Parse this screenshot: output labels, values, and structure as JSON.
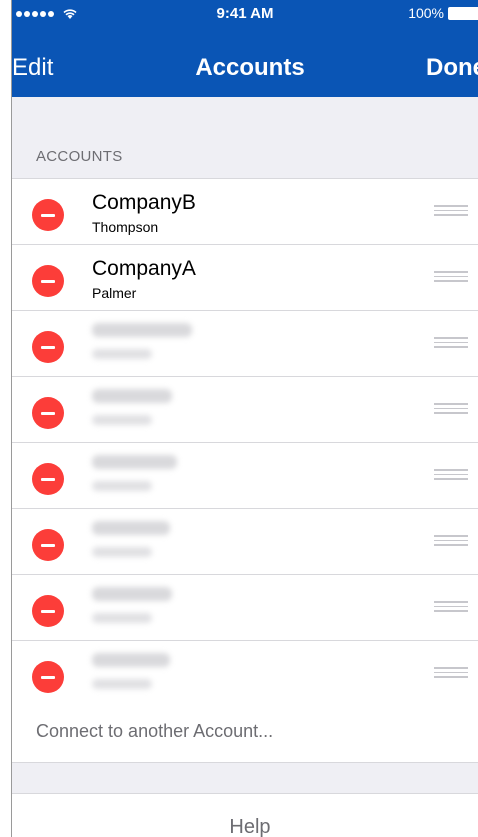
{
  "status_bar": {
    "time": "9:41 AM",
    "battery": "100%"
  },
  "nav": {
    "left_label": "Edit",
    "title": "Accounts",
    "right_label": "Done"
  },
  "section": {
    "header": "ACCOUNTS"
  },
  "accounts": [
    {
      "name": "CompanyB",
      "user": "Thompson"
    },
    {
      "name": "CompanyA",
      "user": "Palmer"
    }
  ],
  "connect_label": "Connect to another Account...",
  "help_label": "Help",
  "colors": {
    "nav_background": "#0a55b5",
    "delete_red": "#fc3d39",
    "group_background": "#efeff4"
  },
  "icons": {
    "delete": "minus-circle-icon",
    "reorder": "reorder-handle-icon",
    "wifi": "wifi-icon",
    "battery": "battery-icon"
  }
}
